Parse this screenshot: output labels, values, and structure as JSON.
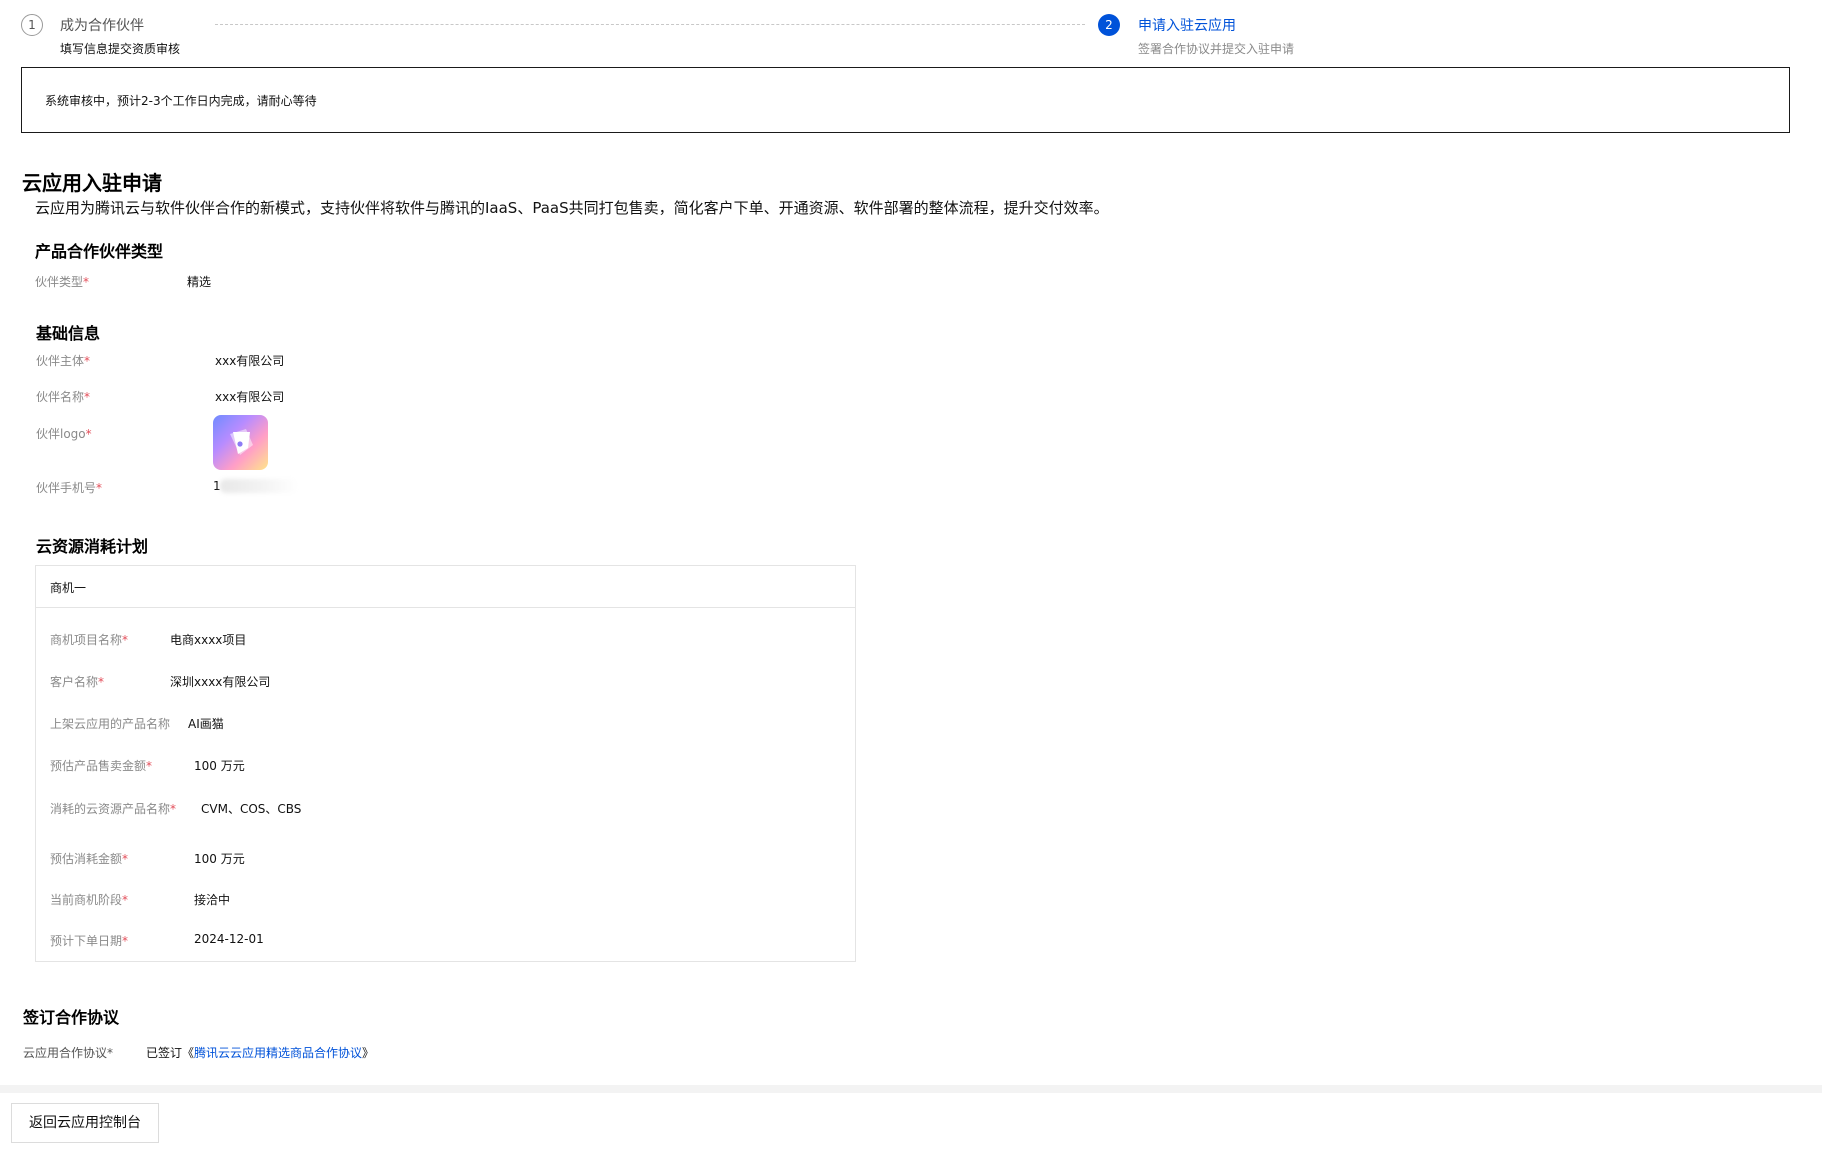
{
  "steps": [
    {
      "number": "1",
      "title": "成为合作伙伴",
      "desc": "填写信息提交资质审核"
    },
    {
      "number": "2",
      "title": "申请入驻云应用",
      "desc": "签署合作协议并提交入驻申请"
    }
  ],
  "notice": "系统审核中，预计2-3个工作日内完成，请耐心等待",
  "page": {
    "title": "云应用入驻申请",
    "description": "云应用为腾讯云与软件伙伴合作的新模式，支持伙伴将软件与腾讯的IaaS、PaaS共同打包售卖，简化客户下单、开通资源、软件部署的整体流程，提升交付效率。"
  },
  "partner_type_section": {
    "title": "产品合作伙伴类型",
    "label": "伙伴类型",
    "value": "精选"
  },
  "basic_info": {
    "title": "基础信息",
    "entity_label": "伙伴主体",
    "entity_value": "xxx有限公司",
    "name_label": "伙伴名称",
    "name_value": "xxx有限公司",
    "logo_label": "伙伴logo",
    "phone_label": "伙伴手机号",
    "phone_value": "1"
  },
  "consumption": {
    "title": "云资源消耗计划",
    "card_title": "商机一",
    "project_label": "商机项目名称",
    "project_value": "电商xxxx项目",
    "customer_label": "客户名称",
    "customer_value": "深圳xxxx有限公司",
    "product_label": "上架云应用的产品名称",
    "product_value": "AI画猫",
    "sales_label": "预估产品售卖金额",
    "sales_value": "100 万元",
    "resources_label": "消耗的云资源产品名称",
    "resources_value": "CVM、COS、CBS",
    "consume_label": "预估消耗金额",
    "consume_value": "100 万元",
    "stage_label": "当前商机阶段",
    "stage_value": "接洽中",
    "date_label": "预计下单日期",
    "date_value": "2024-12-01"
  },
  "agreement": {
    "title": "签订合作协议",
    "label": "云应用合作协议*",
    "prefix": "已签订《",
    "link": "腾讯云云应用精选商品合作协议",
    "suffix": "》"
  },
  "footer": {
    "back_button": "返回云应用控制台"
  },
  "required_mark": "*",
  "colors": {
    "primary": "#0052d9",
    "required": "#e34d59",
    "label": "#8a8a8a"
  }
}
